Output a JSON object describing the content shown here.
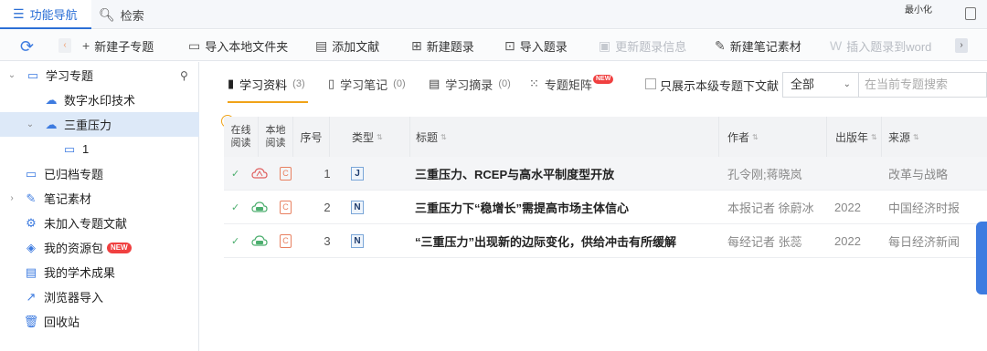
{
  "topbar": {
    "tabs": [
      {
        "label": "功能导航",
        "icon": "menu-icon",
        "active": true
      },
      {
        "label": "检索",
        "icon": "search-icon",
        "active": false
      }
    ],
    "minimize_label": "最小化"
  },
  "toolbar": {
    "buttons": [
      {
        "label": "新建子专题",
        "icon": "plus-icon",
        "disabled": false
      },
      {
        "label": "导入本地文件夹",
        "icon": "folder-icon",
        "disabled": false
      },
      {
        "label": "添加文献",
        "icon": "add-doc-icon",
        "disabled": false
      },
      {
        "label": "新建题录",
        "icon": "new-record-icon",
        "disabled": false
      },
      {
        "label": "导入题录",
        "icon": "import-record-icon",
        "disabled": false
      },
      {
        "label": "更新题录信息",
        "icon": "update-icon",
        "disabled": true
      },
      {
        "label": "新建笔记素材",
        "icon": "note-icon",
        "disabled": false
      },
      {
        "label": "插入题录到word",
        "icon": "word-icon",
        "disabled": true
      }
    ]
  },
  "sidebar": {
    "items": [
      {
        "label": "学习专题",
        "icon": "folder-icon",
        "expanded": true,
        "depth": 0
      },
      {
        "label": "数字水印技术",
        "icon": "cloud-folder-icon",
        "depth": 1
      },
      {
        "label": "三重压力",
        "icon": "cloud-folder-icon",
        "expanded": true,
        "depth": 1,
        "selected": true
      },
      {
        "label": "1",
        "icon": "folder-icon",
        "depth": 2
      },
      {
        "label": "已归档专题",
        "icon": "archive-icon",
        "depth": 0
      },
      {
        "label": "笔记素材",
        "icon": "note-icon",
        "depth": 0
      },
      {
        "label": "未加入专题文献",
        "icon": "gear-doc-icon",
        "depth": 0
      },
      {
        "label": "我的资源包",
        "icon": "layers-icon",
        "depth": 0,
        "badge": "NEW"
      },
      {
        "label": "我的学术成果",
        "icon": "achievement-icon",
        "depth": 0
      },
      {
        "label": "浏览器导入",
        "icon": "browser-icon",
        "depth": 0
      },
      {
        "label": "回收站",
        "icon": "trash-icon",
        "depth": 0
      }
    ]
  },
  "content_tabs": [
    {
      "label": "学习资料",
      "count": "(3)",
      "active": true
    },
    {
      "label": "学习笔记",
      "count": "(0)",
      "active": false
    },
    {
      "label": "学习摘录",
      "count": "(0)",
      "active": false
    },
    {
      "label": "专题矩阵",
      "count": "",
      "active": false,
      "badge": "NEW"
    }
  ],
  "filter": {
    "checkbox_label": "只展示本级专题下文献",
    "select_value": "全部",
    "search_placeholder": "在当前专题搜索"
  },
  "table": {
    "headers": {
      "online_read": [
        "在线",
        "阅读"
      ],
      "local_read": [
        "本地",
        "阅读"
      ],
      "num": "序号",
      "type": "类型",
      "title": "标题",
      "author": "作者",
      "year": "出版年",
      "source": "来源"
    },
    "rows": [
      {
        "num": "1",
        "type": "J",
        "title": "三重压力、RCEP与高水平制度型开放",
        "author": "孔令刚;蒋晓岚",
        "year": "",
        "source": "改革与战略",
        "online_icon": "pdf-cloud-icon",
        "color": "#e06060"
      },
      {
        "num": "2",
        "type": "N",
        "title": "三重压力下“稳增长”需提高市场主体信心",
        "author": "本报记者 徐蔚冰",
        "year": "2022",
        "source": "中国经济时报",
        "online_icon": "xml-cloud-icon",
        "color": "#4cae6e"
      },
      {
        "num": "3",
        "type": "N",
        "title": "“三重压力”出现新的边际变化，供给冲击有所缓解",
        "author": "每经记者 张蕊",
        "year": "2022",
        "source": "每日经济新闻",
        "online_icon": "xml-cloud-icon",
        "color": "#4cae6e"
      }
    ]
  }
}
